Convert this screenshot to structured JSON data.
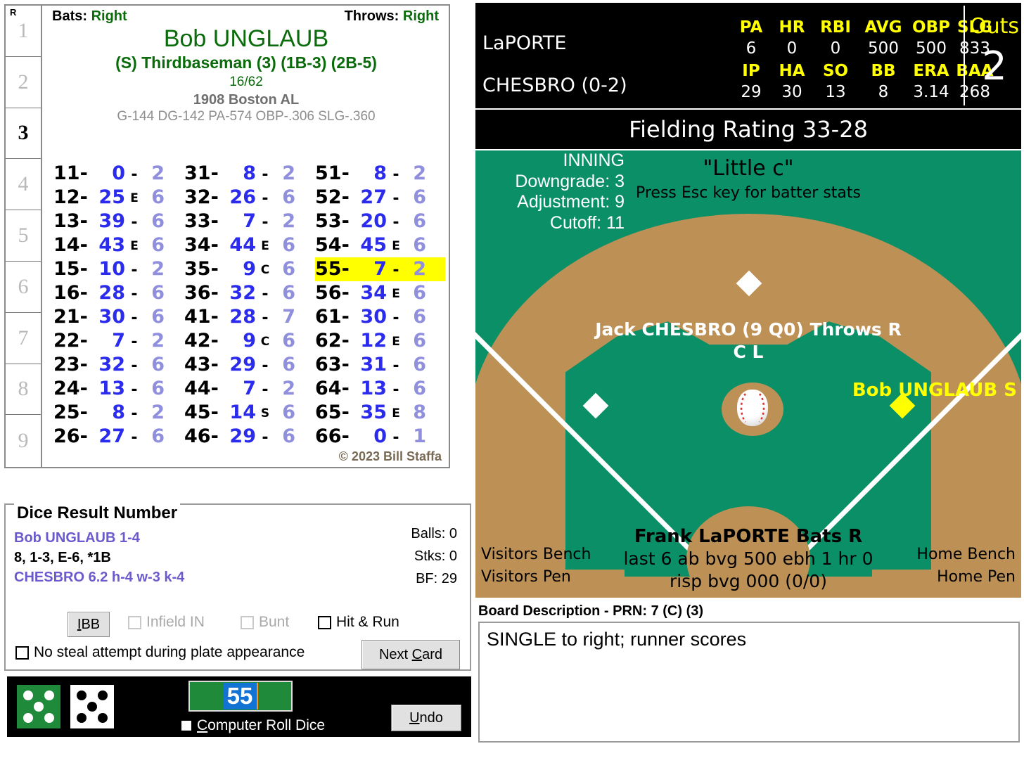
{
  "inning_strip": {
    "header": "R",
    "innings": [
      "1",
      "2",
      "3",
      "4",
      "5",
      "6",
      "7",
      "8",
      "9"
    ],
    "active": "3"
  },
  "player_card": {
    "bats_label": "Bats:",
    "bats_value": "Right",
    "throws_label": "Throws:",
    "throws_value": "Right",
    "name": "Bob UNGLAUB",
    "position": "(S) Thirdbaseman (3) (1B-3) (2B-5)",
    "card_number": "16/62",
    "team": "1908 Boston AL",
    "stat_line": "G-144 DG-142 PA-574 OBP-.306 SLG-.360",
    "copyright": "© 2023 Bill Staffa",
    "columns": [
      [
        {
          "key": "11-",
          "val": "0",
          "flag": "-",
          "last": "2"
        },
        {
          "key": "12-",
          "val": "25",
          "flag": "E",
          "last": "6"
        },
        {
          "key": "13-",
          "val": "39",
          "flag": "-",
          "last": "6"
        },
        {
          "key": "14-",
          "val": "43",
          "flag": "E",
          "last": "6"
        },
        {
          "key": "15-",
          "val": "10",
          "flag": "-",
          "last": "2"
        },
        {
          "key": "16-",
          "val": "28",
          "flag": "-",
          "last": "6"
        },
        {
          "key": "21-",
          "val": "30",
          "flag": "-",
          "last": "6"
        },
        {
          "key": "22-",
          "val": "7",
          "flag": "-",
          "last": "2"
        },
        {
          "key": "23-",
          "val": "32",
          "flag": "-",
          "last": "6"
        },
        {
          "key": "24-",
          "val": "13",
          "flag": "-",
          "last": "6"
        },
        {
          "key": "25-",
          "val": "8",
          "flag": "-",
          "last": "2"
        },
        {
          "key": "26-",
          "val": "27",
          "flag": "-",
          "last": "6"
        }
      ],
      [
        {
          "key": "31-",
          "val": "8",
          "flag": "-",
          "last": "2"
        },
        {
          "key": "32-",
          "val": "26",
          "flag": "-",
          "last": "6"
        },
        {
          "key": "33-",
          "val": "7",
          "flag": "-",
          "last": "2"
        },
        {
          "key": "34-",
          "val": "44",
          "flag": "E",
          "last": "6"
        },
        {
          "key": "35-",
          "val": "9",
          "flag": "C",
          "last": "6"
        },
        {
          "key": "36-",
          "val": "32",
          "flag": "-",
          "last": "6"
        },
        {
          "key": "41-",
          "val": "28",
          "flag": "-",
          "last": "7"
        },
        {
          "key": "42-",
          "val": "9",
          "flag": "C",
          "last": "6"
        },
        {
          "key": "43-",
          "val": "29",
          "flag": "-",
          "last": "6"
        },
        {
          "key": "44-",
          "val": "7",
          "flag": "-",
          "last": "2"
        },
        {
          "key": "45-",
          "val": "14",
          "flag": "S",
          "last": "6"
        },
        {
          "key": "46-",
          "val": "29",
          "flag": "-",
          "last": "6"
        }
      ],
      [
        {
          "key": "51-",
          "val": "8",
          "flag": "-",
          "last": "2"
        },
        {
          "key": "52-",
          "val": "27",
          "flag": "-",
          "last": "6"
        },
        {
          "key": "53-",
          "val": "20",
          "flag": "-",
          "last": "6"
        },
        {
          "key": "54-",
          "val": "45",
          "flag": "E",
          "last": "6"
        },
        {
          "key": "55-",
          "val": "7",
          "flag": "-",
          "last": "2",
          "highlight": true
        },
        {
          "key": "56-",
          "val": "34",
          "flag": "E",
          "last": "6"
        },
        {
          "key": "61-",
          "val": "30",
          "flag": "-",
          "last": "6"
        },
        {
          "key": "62-",
          "val": "12",
          "flag": "E",
          "last": "6"
        },
        {
          "key": "63-",
          "val": "31",
          "flag": "-",
          "last": "6"
        },
        {
          "key": "64-",
          "val": "13",
          "flag": "-",
          "last": "6"
        },
        {
          "key": "65-",
          "val": "35",
          "flag": "E",
          "last": "8"
        },
        {
          "key": "66-",
          "val": "0",
          "flag": "-",
          "last": "1"
        }
      ]
    ]
  },
  "dice_panel": {
    "title": "Dice Result Number",
    "batter_line": "Bob UNGLAUB  1-4",
    "result_line": "8, 1-3, E-6, *1B",
    "pitcher_line": "CHESBRO  6.2  h-4  w-3  k-4",
    "balls": "Balls: 0",
    "strikes": "Stks: 0",
    "bf": "BF: 29",
    "ibb_label": "IBB",
    "infield_in_label": "Infield IN",
    "bunt_label": "Bunt",
    "hit_run_label": "Hit & Run",
    "no_steal_label": "No steal attempt during plate appearance",
    "next_card_label": "Next Card"
  },
  "dice_bar": {
    "die1_value": 5,
    "die2_value": 5,
    "roll_value": "55",
    "computer_roll_label": "Computer Roll Dice",
    "undo_label": "Undo"
  },
  "scoreboard": {
    "batter_name": "LaPORTE",
    "batter_headers": [
      "PA",
      "HR",
      "RBI",
      "AVG",
      "OBP",
      "SLG"
    ],
    "batter_values": [
      "6",
      "0",
      "0",
      "500",
      "500",
      "833"
    ],
    "pitcher_name": "CHESBRO (0-2)",
    "pitcher_headers": [
      "IP",
      "HA",
      "SO",
      "BB",
      "ERA",
      "BAA"
    ],
    "pitcher_values": [
      "29",
      "30",
      "13",
      "8",
      "3.14",
      "268"
    ],
    "outs_label": "Outs",
    "outs_value": "2"
  },
  "fielding": {
    "bar_text": "Fielding Rating 33-28"
  },
  "field": {
    "little_c": "\"Little c\"",
    "esc_hint": "Press Esc key for batter stats",
    "pitcher_line": "Jack CHESBRO (9 Q0) Throws R",
    "pitcher_sub": "C L",
    "runner_first": "Bob UNGLAUB S",
    "inning_label": "INNING",
    "downgrade": "Downgrade: 3",
    "adjustment": "Adjustment: 9",
    "cutoff": "Cutoff: 11",
    "batter_name": "Frank LaPORTE Bats R",
    "batter_line1": "last 6 ab bvg 500 ebh 1 hr 0",
    "batter_line2": "risp bvg 000 (0/0)",
    "visitors_bench": "Visitors Bench",
    "visitors_pen": "Visitors Pen",
    "home_bench": "Home Bench",
    "home_pen": "Home Pen"
  },
  "board_description": {
    "label": "Board Description - PRN: 7 (C) (3)",
    "text": "SINGLE to right; runner scores"
  }
}
